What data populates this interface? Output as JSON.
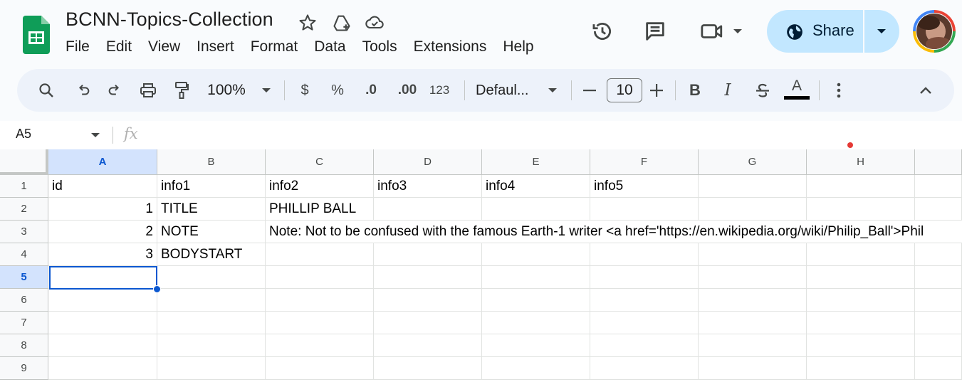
{
  "document": {
    "title": "BCNN-Topics-Collection"
  },
  "menu": [
    "File",
    "Edit",
    "View",
    "Insert",
    "Format",
    "Data",
    "Tools",
    "Extensions",
    "Help"
  ],
  "share": {
    "label": "Share"
  },
  "toolbar": {
    "zoom": "100%",
    "currency": "$",
    "percent": "%",
    "decrease_decimal": ".0",
    "increase_decimal": ".00",
    "number_format": "123",
    "font": "Defaul...",
    "font_size": "10",
    "bold": "B",
    "italic": "I",
    "text_color_letter": "A"
  },
  "formula_bar": {
    "cell_ref": "A5",
    "fx": "fx",
    "value": ""
  },
  "sheet": {
    "columns": [
      "A",
      "B",
      "C",
      "D",
      "E",
      "F",
      "G",
      "H"
    ],
    "rows": [
      "1",
      "2",
      "3",
      "4",
      "5",
      "6",
      "7",
      "8",
      "9"
    ],
    "selected_cell": "A5",
    "cells": {
      "A1": "id",
      "B1": "info1",
      "C1": "info2",
      "D1": "info3",
      "E1": "info4",
      "F1": "info5",
      "A2": "1",
      "B2": "TITLE",
      "C2": "PHILLIP BALL",
      "A3": "2",
      "B3": "NOTE",
      "C3": "Note: Not to be confused with the famous Earth-1 writer <a href='https://en.wikipedia.org/wiki/Philip_Ball'>Phil",
      "A4": "3",
      "B4": "BODYSTART"
    }
  },
  "colors": {
    "accent": "#0b57d0",
    "share_bg": "#c2e7ff",
    "sheets_green": "#0f9d58"
  }
}
